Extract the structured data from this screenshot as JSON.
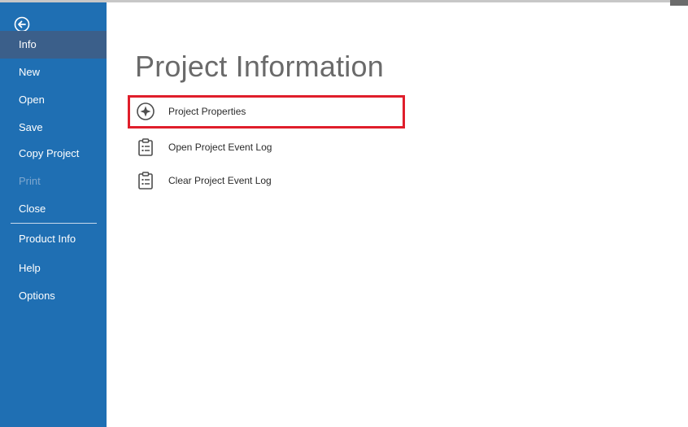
{
  "sidebar": {
    "back": {
      "icon": "back-arrow-icon"
    },
    "items": [
      {
        "label": "Info",
        "state": "selected"
      },
      {
        "label": "New",
        "state": "normal"
      },
      {
        "label": "Open",
        "state": "normal"
      },
      {
        "label": "Save",
        "state": "normal"
      },
      {
        "label": "Copy Project",
        "state": "normal"
      },
      {
        "label": "Print",
        "state": "disabled"
      },
      {
        "label": "Close",
        "state": "normal"
      },
      {
        "label": "Product Info",
        "state": "normal"
      },
      {
        "label": "Help",
        "state": "normal"
      },
      {
        "label": "Options",
        "state": "normal"
      }
    ]
  },
  "main": {
    "title": "Project Information",
    "actions": [
      {
        "label": "Project Properties",
        "icon": "properties-compass-icon",
        "highlighted": true
      },
      {
        "label": "Open Project Event Log",
        "icon": "clipboard-list-icon",
        "highlighted": false
      },
      {
        "label": "Clear Project Event Log",
        "icon": "clipboard-list-icon",
        "highlighted": false
      }
    ]
  },
  "colors": {
    "sidebar_bg": "#1f6fb3",
    "selected_bg": "#3b5f8a",
    "highlight": "#e01e2b",
    "title_text": "#6a6a6a"
  }
}
